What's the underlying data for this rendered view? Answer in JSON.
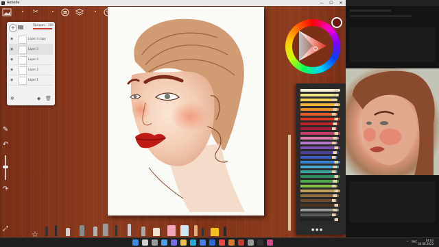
{
  "window": {
    "title": "Rebelle",
    "minimize_icon": "minimize-icon",
    "maximize_icon": "maximize-icon",
    "close_icon": "close-icon"
  },
  "toolbar": {
    "icons": [
      "gallery-icon",
      "star-icon",
      "brush-settings-icon",
      "menu-icon",
      "layers-icon",
      "stencil-icon",
      "grid-icon",
      "camera-icon"
    ]
  },
  "layers_panel": {
    "opacity_label": "Прозрач.",
    "opacity_value": "100",
    "opacity_fraction": 1.0,
    "layers": [
      {
        "name": "Layer 4 copy",
        "selected": false
      },
      {
        "name": "Layer 3",
        "selected": true
      },
      {
        "name": "Layer 4",
        "selected": false
      },
      {
        "name": "Layer 2",
        "selected": false
      },
      {
        "name": "Layer 1",
        "selected": false
      }
    ]
  },
  "left_tools": [
    "pencil-icon",
    "undo-icon",
    "size-slider",
    "redo-icon",
    "fullscreen-icon"
  ],
  "color": {
    "current": "#6a1a12",
    "wheel_selected": "#c0301a"
  },
  "pencil_colors": [
    "#f6f0d6",
    "#f2e88a",
    "#f0d35a",
    "#f2b33c",
    "#e98a2c",
    "#e4602a",
    "#d63a26",
    "#b8242a",
    "#9e1e3a",
    "#c43c6c",
    "#d979a6",
    "#b57ac7",
    "#7a4fb0",
    "#4a3f9c",
    "#3a5cc0",
    "#3b86d0",
    "#49a8d6",
    "#3aa6a0",
    "#2f8a62",
    "#49a84a",
    "#86c14a",
    "#bfa05a",
    "#8c6a3c",
    "#6b4a2e",
    "#4a3424",
    "#9a9a9a",
    "#5a5a5a",
    "#222222"
  ],
  "bottom_tools": [
    "star-icon",
    "pencil-tool",
    "pen-tool",
    "ink-tool",
    "airbrush-tool",
    "smudge-tool",
    "palette-knife-tool",
    "eraser-tool",
    "marker-tool",
    "blender-tool",
    "cutter-tool",
    "pastel-tool",
    "watercolor-tool",
    "crayon-tool",
    "paint-tool"
  ],
  "taskbar": {
    "apps": [
      "windows-start-icon",
      "search-icon",
      "task-view-icon",
      "widgets-icon",
      "chat-icon",
      "explorer-icon",
      "edge-icon",
      "store-icon",
      "mail-icon",
      "calendar-icon",
      "photos-icon",
      "rebelle-icon",
      "settings-icon",
      "terminal-icon",
      "media-icon"
    ],
    "tray_label": "^",
    "language": "РУС",
    "time": "14:03",
    "date": "30.06.2023"
  }
}
